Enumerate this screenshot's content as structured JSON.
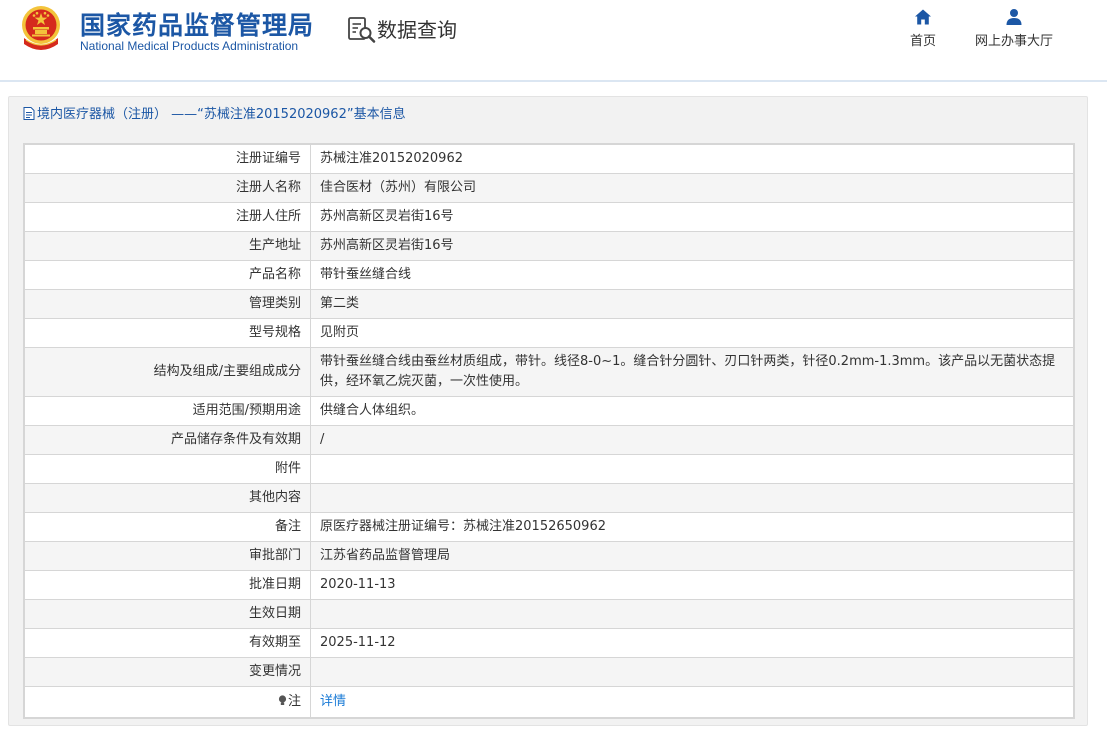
{
  "header": {
    "logo_cn": "国家药品监督管理局",
    "logo_en": "National Medical Products Administration",
    "section_title": "数据查询",
    "nav": {
      "home_label": "首页",
      "online_hall_label": "网上办事大厅"
    },
    "colors": {
      "brand": "#1c57a5",
      "emblem_red": "#d52a1d",
      "emblem_gold": "#f3c43b"
    }
  },
  "panel": {
    "title": "境内医疗器械（注册） ——“苏械注准20152020962”基本信息"
  },
  "rows": [
    {
      "label": "注册证编号",
      "value": "苏械注准20152020962"
    },
    {
      "label": "注册人名称",
      "value": "佳合医材（苏州）有限公司"
    },
    {
      "label": "注册人住所",
      "value": "苏州高新区灵岩街16号"
    },
    {
      "label": "生产地址",
      "value": "苏州高新区灵岩街16号"
    },
    {
      "label": "产品名称",
      "value": "带针蚕丝缝合线"
    },
    {
      "label": "管理类别",
      "value": "第二类"
    },
    {
      "label": "型号规格",
      "value": "见附页"
    },
    {
      "label": "结构及组成/主要组成成分",
      "value": "带针蚕丝缝合线由蚕丝材质组成，带针。线径8-0~1。缝合针分圆针、刃口针两类，针径0.2mm-1.3mm。该产品以无菌状态提供，经环氧乙烷灭菌，一次性使用。"
    },
    {
      "label": "适用范围/预期用途",
      "value": "供缝合人体组织。"
    },
    {
      "label": "产品储存条件及有效期",
      "value": "/"
    },
    {
      "label": "附件",
      "value": ""
    },
    {
      "label": "其他内容",
      "value": ""
    },
    {
      "label": "备注",
      "value": "原医疗器械注册证编号：苏械注准20152650962"
    },
    {
      "label": "审批部门",
      "value": "江苏省药品监督管理局"
    },
    {
      "label": "批准日期",
      "value": "2020-11-13"
    },
    {
      "label": "生效日期",
      "value": ""
    },
    {
      "label": "有效期至",
      "value": "2025-11-12"
    },
    {
      "label": "变更情况",
      "value": ""
    }
  ],
  "note_row": {
    "label": "注",
    "link_text": "详情",
    "icon": "lightbulb-icon"
  }
}
